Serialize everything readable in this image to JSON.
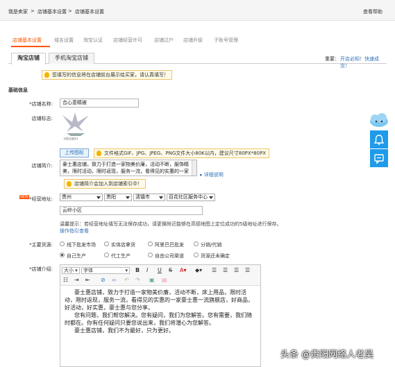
{
  "breadcrumb": {
    "items": [
      "我是卖家",
      ">",
      "店铺基本设置",
      ">",
      "店铺基本设置"
    ],
    "help": "查看帮助"
  },
  "tabs": [
    "店铺基本设置",
    "域名设置",
    "淘宝认证",
    "店铺经营许可",
    "店铺过户",
    "店铺升级",
    "子账号管理"
  ],
  "subtabs": [
    "淘宝店铺",
    "手机淘宝店铺"
  ],
  "top_links": {
    "important": "重要：",
    "link": "开店必知！快速成交！"
  },
  "notice": "您填写的信息将在店铺前台展示给买家，请认真填写！",
  "section_title": "基础信息",
  "shop_name": {
    "label": "*店铺名称:",
    "value": "合心意精被"
  },
  "shop_logo": {
    "label": "店铺标志:",
    "logo_text": "HEXINYI",
    "upload_label": "上传图标",
    "hint": "文件格式GIF、JPG、JPEG、PNG文件大小80K以内，建议尺寸80PX*80PX"
  },
  "shop_intro": {
    "label": "店铺简介:",
    "value": "豪士惠店铺，致力于打造一家物美价廉，活动不断，服饰精美，限时活动，限时返现，服务一流，看得见的实惠的一家豪",
    "detail_link": "详细说明",
    "notice": "店铺简介会加入到店铺索引中！"
  },
  "address": {
    "badge": "NEW",
    "label": "*经营地址:",
    "selects": [
      "贵州",
      "贵阳",
      "清镇市",
      "百花社区服务中心"
    ],
    "detail": "云岭小区",
    "tip_prefix": "温馨提示：",
    "tip": "若经营地址填写无法保存成功，请更换附近能够在高德地图上定位成功的5级地址进行保存。",
    "tip_link": "操作指引查看"
  },
  "main_source": {
    "label": "*主要货源:",
    "options": [
      "线下批发市场",
      "实体店拿货",
      "阿里巴巴批发",
      "分销/代销",
      "自己生产",
      "代工生产",
      "自由公司渠道",
      "货源还未确定"
    ],
    "selected": "自己生产"
  },
  "shop_desc": {
    "label": "*店铺介绍:",
    "toolbar": {
      "size": "大小",
      "font": "字体",
      "bold": "B",
      "italic": "I",
      "underline": "U",
      "strike": "S"
    },
    "paragraphs": [
      "豪士惠店铺，致力于打造一家物美价廉，活动不断，床上用品，限时活动，限时返现，服务一流，看得见的实惠的一家豪士惠一流旗舰店，好商品，好活动，好实惠，豪士惠与您分享。",
      "您有问题，我们帮您解决。您有疑问，我们为您解答。您有需要，我们随时都在。你有任何疑问只要您说出来，我们将潜心为您解答。",
      "豪士惠店铺，我们不为最好，只为更好。"
    ]
  },
  "watermark": "头条 @贵阳网络人老吴",
  "colors": {
    "accent": "#ff5500",
    "link": "#2e6fb7",
    "side_button": "#1e9bea"
  }
}
